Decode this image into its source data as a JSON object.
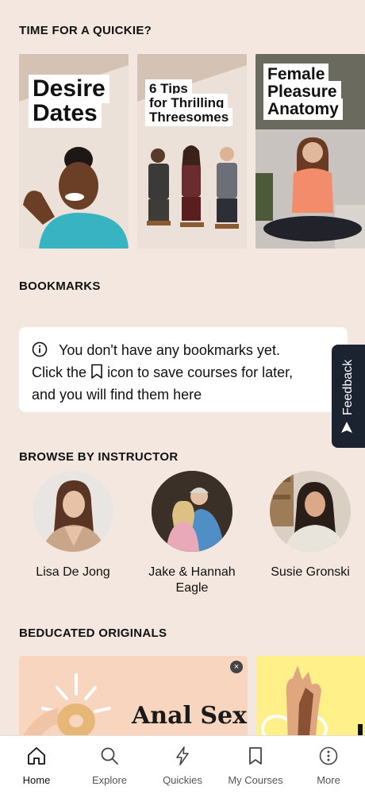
{
  "quickies": {
    "section_title": "TIME FOR A QUICKIE?",
    "cards": [
      {
        "title_line1": "Desire",
        "title_line2": "Dates"
      },
      {
        "title_line1": "6 Tips",
        "title_line2": "for Thrilling",
        "title_line3": "Threesomes"
      },
      {
        "title_line1": "Female",
        "title_line2": "Pleasure",
        "title_line3": "Anatomy"
      }
    ]
  },
  "bookmarks": {
    "section_title": "BOOKMARKS",
    "line1": "You don't have any bookmarks yet.",
    "line2_before": "Click the",
    "line2_after": "icon to save courses for later,",
    "line3": "and you will find them here"
  },
  "feedback": {
    "label": "Feedback"
  },
  "instructors": {
    "section_title": "BROWSE BY INSTRUCTOR",
    "items": [
      {
        "name": "Lisa De Jong"
      },
      {
        "name": "Jake & Hannah Eagle"
      },
      {
        "name": "Susie Gronski"
      }
    ]
  },
  "originals": {
    "section_title": "BEDUCATED ORIGINALS",
    "card1_title": "Anal Sex"
  },
  "nav": {
    "items": [
      {
        "label": "Home",
        "icon": "home-icon"
      },
      {
        "label": "Explore",
        "icon": "search-icon"
      },
      {
        "label": "Quickies",
        "icon": "lightning-icon"
      },
      {
        "label": "My Courses",
        "icon": "bookmark-icon"
      },
      {
        "label": "More",
        "icon": "more-icon"
      }
    ]
  },
  "colors": {
    "background": "#f3e7df",
    "feedback_tab": "#1b2230",
    "card_pink": "#f7d5bf",
    "card_yellow": "#fff08a"
  }
}
